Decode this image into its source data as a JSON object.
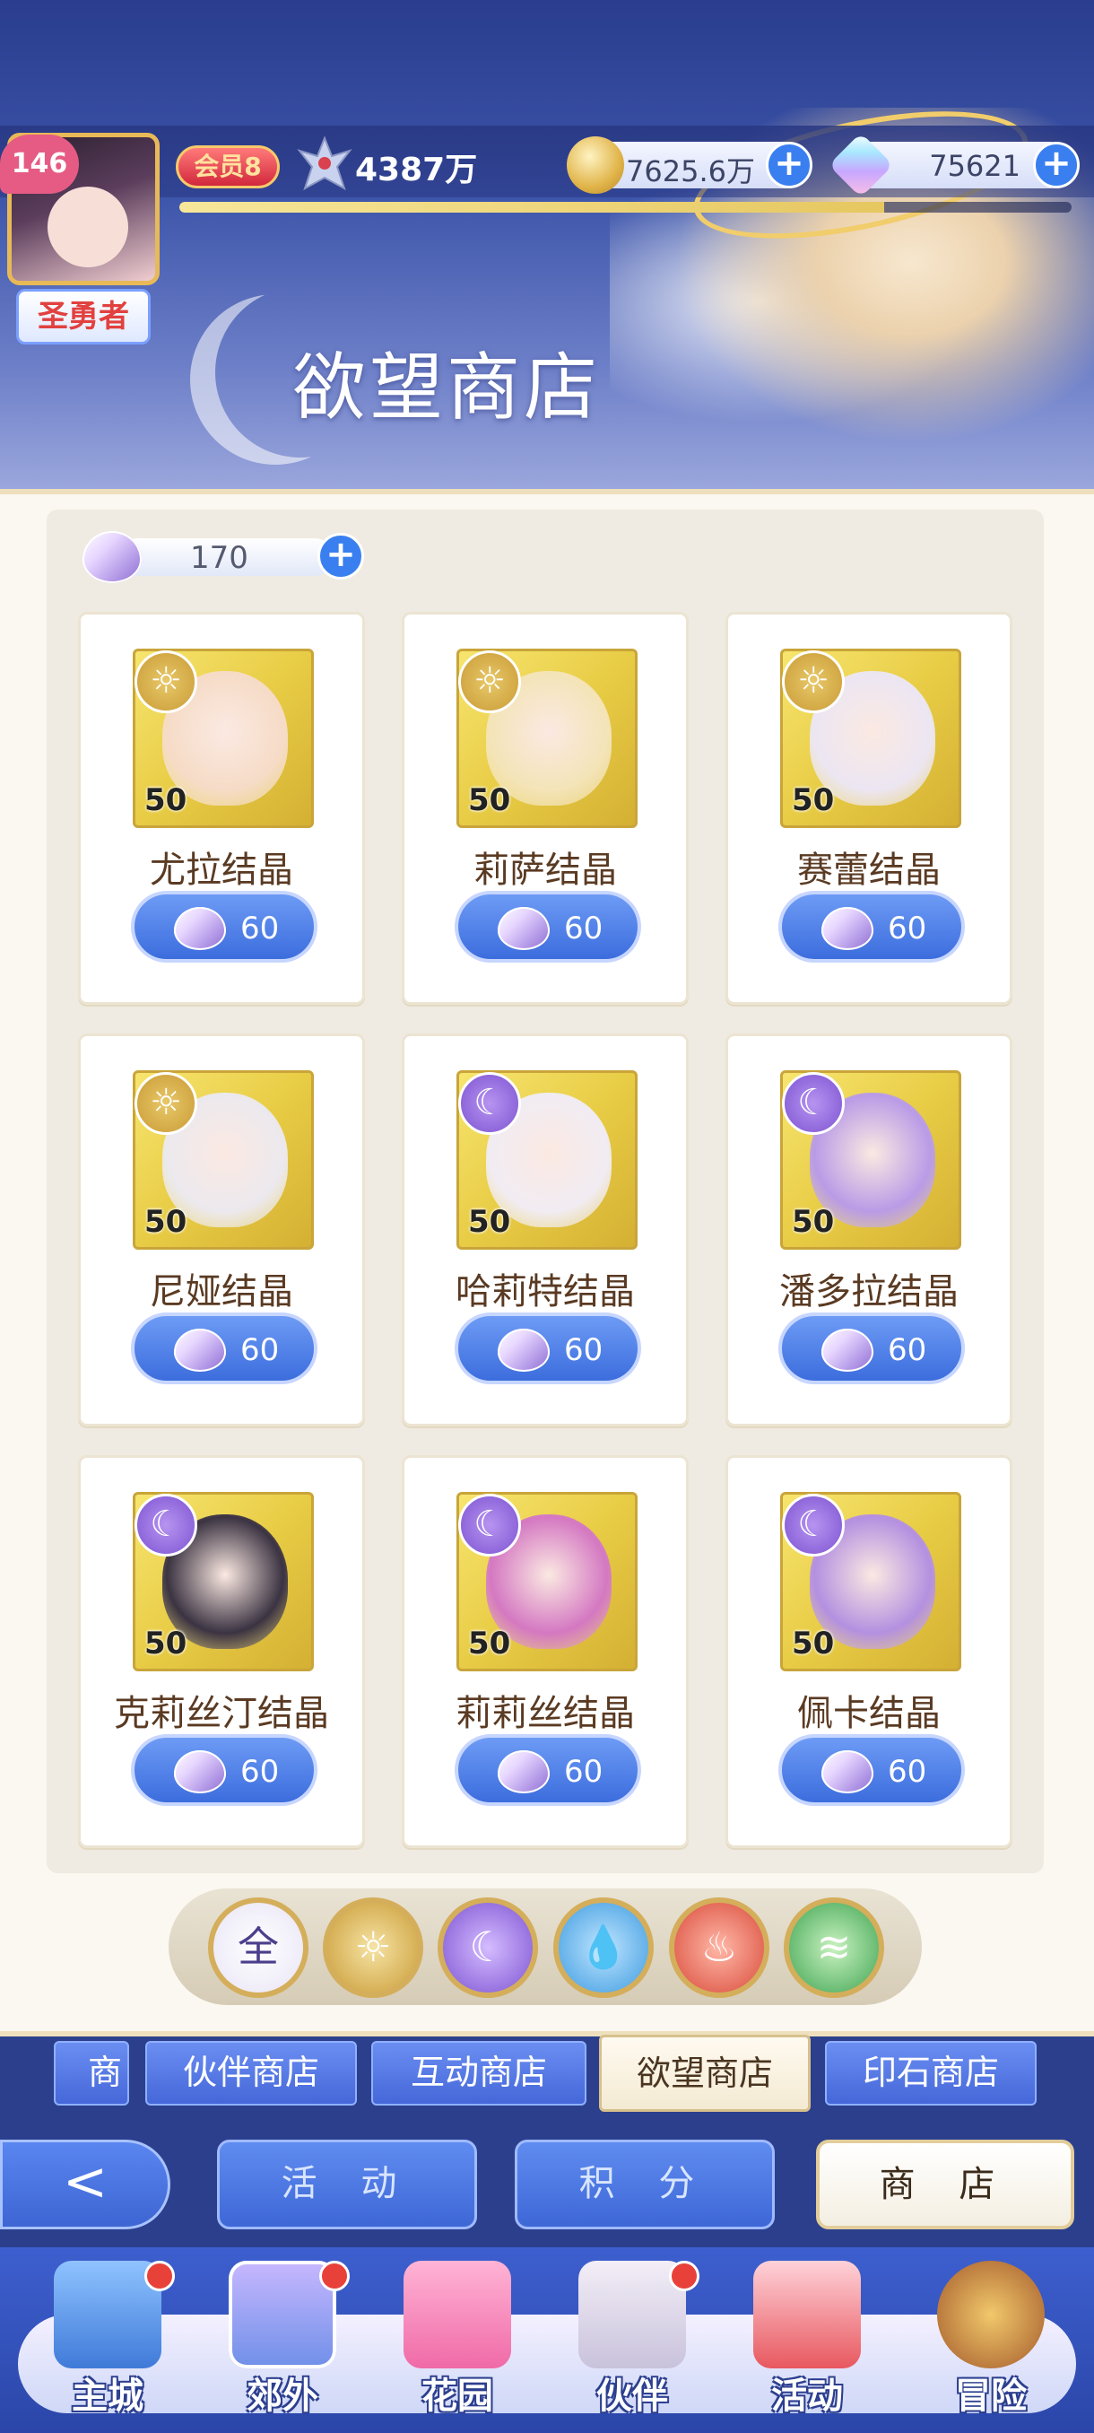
{
  "header": {
    "player_level": "146",
    "player_title": "圣勇者",
    "vip_label": "会员8",
    "power_value": "4387万",
    "gold_value": "7625.6万",
    "diamond_value": "75621",
    "exp_progress_percent": 79,
    "page_title": "欲望商店"
  },
  "shop": {
    "currency_balance": "170",
    "items": [
      {
        "name": "尤拉结晶",
        "qty": "50",
        "price": "60",
        "element": "sun",
        "face_color": "#f6dcc7"
      },
      {
        "name": "莉萨结晶",
        "qty": "50",
        "price": "60",
        "element": "sun",
        "face_color": "#f4e4b8"
      },
      {
        "name": "赛蕾结晶",
        "qty": "50",
        "price": "60",
        "element": "sun",
        "face_color": "#ece6f2"
      },
      {
        "name": "尼娅结晶",
        "qty": "50",
        "price": "60",
        "element": "sun",
        "face_color": "#ece9ee"
      },
      {
        "name": "哈莉特结晶",
        "qty": "50",
        "price": "60",
        "element": "moon",
        "face_color": "#f1ecf3"
      },
      {
        "name": "潘多拉结晶",
        "qty": "50",
        "price": "60",
        "element": "moon",
        "face_color": "#b99be6"
      },
      {
        "name": "克莉丝汀结晶",
        "qty": "50",
        "price": "60",
        "element": "moon",
        "face_color": "#3b3342"
      },
      {
        "name": "莉莉丝结晶",
        "qty": "50",
        "price": "60",
        "element": "moon",
        "face_color": "#d478c2"
      },
      {
        "name": "佩卡结晶",
        "qty": "50",
        "price": "60",
        "element": "moon",
        "face_color": "#b490e0"
      }
    ],
    "filters": [
      {
        "label": "全",
        "icon": "all-icon"
      },
      {
        "label": "",
        "icon": "sun-icon"
      },
      {
        "label": "",
        "icon": "moon-icon"
      },
      {
        "label": "",
        "icon": "water-icon"
      },
      {
        "label": "",
        "icon": "fire-icon"
      },
      {
        "label": "",
        "icon": "wind-icon"
      }
    ]
  },
  "shop_tabs": [
    "商店",
    "伙伴商店",
    "互动商店",
    "欲望商店",
    "印石商店"
  ],
  "sub_nav": {
    "back_glyph": "<",
    "activity": "活 动",
    "points": "积 分",
    "shop": "商 店"
  },
  "bottom_nav": [
    {
      "label": "主城",
      "badge": true
    },
    {
      "label": "郊外",
      "badge": true
    },
    {
      "label": "花园",
      "badge": false
    },
    {
      "label": "伙伴",
      "badge": true
    },
    {
      "label": "活动",
      "badge": false
    },
    {
      "label": "冒险",
      "badge": false
    }
  ],
  "colors": {
    "accent_blue": "#3c6ddd",
    "gold": "#d4ae5a",
    "sun": "#c99b36",
    "moon": "#7d53d2",
    "water": "#3d9be0",
    "fire": "#d94a3a",
    "wind": "#3fa452"
  }
}
